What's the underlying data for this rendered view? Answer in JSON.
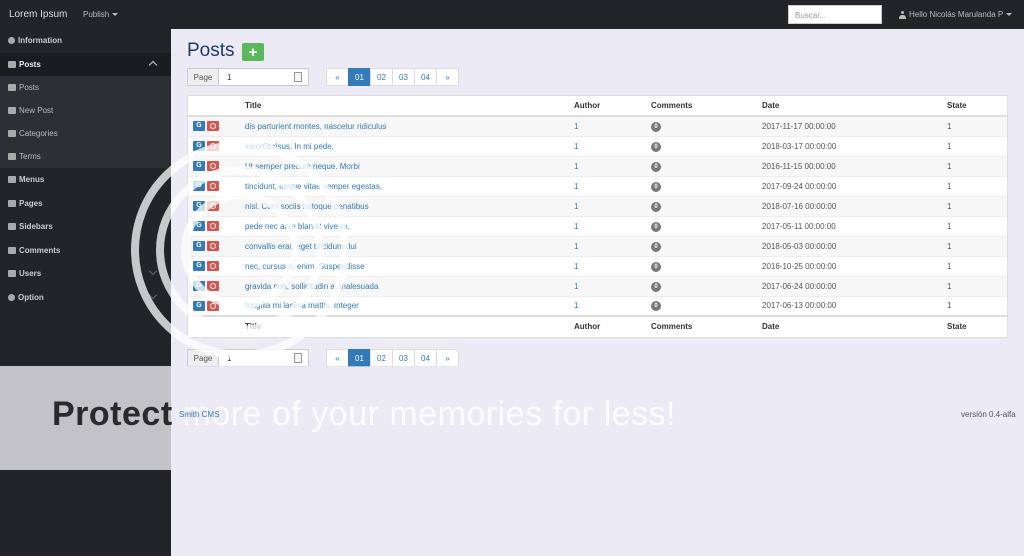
{
  "navbar": {
    "brand": "Lorem Ipsum",
    "publish": "Publish",
    "search_placeholder": "Buscar...",
    "user": "Hello Nicolás Marulanda P"
  },
  "sidebar": {
    "items": [
      {
        "label": "Information"
      },
      {
        "label": "Posts"
      },
      {
        "label": "Posts"
      },
      {
        "label": "New Post"
      },
      {
        "label": "Categories"
      },
      {
        "label": "Terms"
      },
      {
        "label": "Menus"
      },
      {
        "label": "Pages"
      },
      {
        "label": "Sidebars"
      },
      {
        "label": "Comments"
      },
      {
        "label": "Users"
      },
      {
        "label": "Option"
      }
    ]
  },
  "main": {
    "title": "Posts",
    "add_label": "+",
    "page_label": "Page",
    "page_value": "1",
    "pagination": [
      "«",
      "01",
      "02",
      "03",
      "04",
      "»"
    ],
    "columns": [
      "Title",
      "Author",
      "Comments",
      "Date",
      "State"
    ],
    "rows": [
      {
        "g": "G",
        "title": "dis parturient montes, nascetur ridiculus",
        "author": "1",
        "comments": "0",
        "date": "2017-11-17 00:00:00",
        "state": "1"
      },
      {
        "g": "G",
        "title": "lobortis risus. In mi pede,",
        "author": "1",
        "comments": "0",
        "date": "2018-03-17 00:00:00",
        "state": "1"
      },
      {
        "g": "G",
        "title": "Ut semper pretium neque. Morbi",
        "author": "1",
        "comments": "0",
        "date": "2016-11-15 00:00:00",
        "state": "1"
      },
      {
        "g": "G",
        "title": "tincidunt, neque vitae semper egestas,",
        "author": "1",
        "comments": "0",
        "date": "2017-09-24 00:00:00",
        "state": "1"
      },
      {
        "g": "G",
        "title": "nisl. Cum sociis natoque penatibus",
        "author": "1",
        "comments": "0",
        "date": "2018-07-16 00:00:00",
        "state": "1"
      },
      {
        "g": "G",
        "title": "pede nec ante blandit viverra.",
        "author": "1",
        "comments": "0",
        "date": "2017-05-11 00:00:00",
        "state": "1"
      },
      {
        "g": "G",
        "title": "convallis erat, eget tincidunt dui",
        "author": "1",
        "comments": "0",
        "date": "2018-05-03 00:00:00",
        "state": "1"
      },
      {
        "g": "G",
        "title": "nec, cursus a, enim. Suspendisse",
        "author": "1",
        "comments": "0",
        "date": "2016-10-25 00:00:00",
        "state": "1"
      },
      {
        "g": "G",
        "title": "gravida non, sollicitudin a, malesuada",
        "author": "1",
        "comments": "0",
        "date": "2017-06-24 00:00:00",
        "state": "1"
      },
      {
        "g": "G",
        "title": "fringilla mi lacinia mattis. Integer",
        "author": "1",
        "comments": "0",
        "date": "2017-06-13 00:00:00",
        "state": "1"
      }
    ]
  },
  "footer": {
    "left": "Smith CMS",
    "right": "versión 0.4-alfa"
  },
  "watermark": {
    "text_dark": "Protect",
    "text_light": " more of your memories for less!"
  },
  "colors": {
    "navbar_bg": "#222428",
    "page_bg": "#eceaf5",
    "primary": "#337ab7",
    "add_green": "#5cb85c",
    "delete_red": "#d9534f",
    "title_blue": "#1f3c66"
  }
}
